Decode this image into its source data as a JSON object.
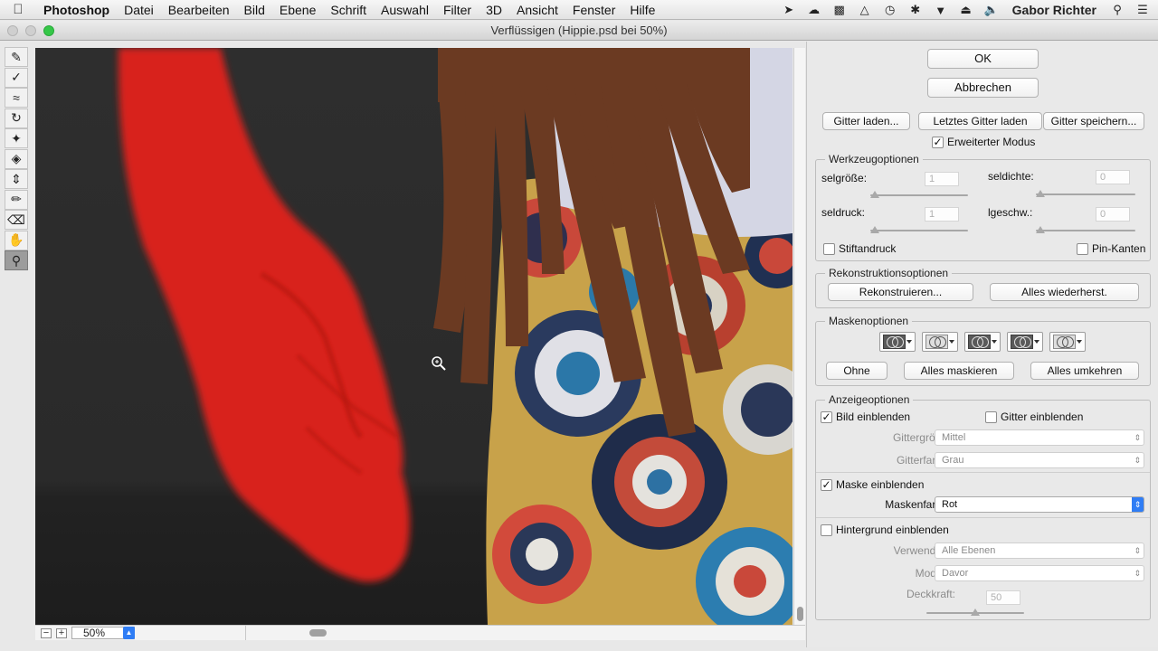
{
  "menubar": {
    "apple_icon": "apple-logo-icon",
    "app_name": "Photoshop",
    "items": [
      "Datei",
      "Bearbeiten",
      "Bild",
      "Ebene",
      "Schrift",
      "Auswahl",
      "Filter",
      "3D",
      "Ansicht",
      "Fenster",
      "Hilfe"
    ],
    "user": "Gabor Richter"
  },
  "window": {
    "title": "Verflüssigen (Hippie.psd bei 50%)"
  },
  "tools": [
    "forward-warp-tool-icon",
    "reconstruct-tool-icon",
    "smooth-tool-icon",
    "twirl-clockwise-tool-icon",
    "pucker-tool-icon",
    "bloat-tool-icon",
    "push-left-tool-icon",
    "freeze-mask-tool-icon",
    "thaw-mask-tool-icon",
    "hand-tool-icon",
    "zoom-tool-icon"
  ],
  "statusbar": {
    "zoom_out": "−",
    "zoom_in": "+",
    "zoom_value": "50%"
  },
  "panel": {
    "ok": "OK",
    "cancel": "Abbrechen",
    "mesh": {
      "load": "Gitter laden...",
      "load_last": "Letztes Gitter laden",
      "save": "Gitter speichern..."
    },
    "advanced_mode": {
      "label": "Erweiterter Modus",
      "checked": true
    },
    "tool_options": {
      "title": "Werkzeugoptionen",
      "brush_size": {
        "label": "selgröße:",
        "value": "1"
      },
      "brush_density": {
        "label": "seldichte:",
        "value": "0"
      },
      "brush_pressure": {
        "label": "seldruck:",
        "value": "1"
      },
      "brush_rate": {
        "label": "lgeschw.:",
        "value": "0"
      },
      "stylus_pressure": {
        "label": "Stiftandruck",
        "checked": false
      },
      "pin_edges": {
        "label": "Pin-Kanten",
        "checked": false
      }
    },
    "reconstruct_options": {
      "title": "Rekonstruktionsoptionen",
      "reconstruct": "Rekonstruieren...",
      "restore_all": "Alles wiederherst."
    },
    "mask_options": {
      "title": "Maskenoptionen",
      "none": "Ohne",
      "mask_all": "Alles maskieren",
      "invert_all": "Alles umkehren"
    },
    "view_options": {
      "title": "Anzeigeoptionen",
      "show_image": {
        "label": "Bild einblenden",
        "checked": true
      },
      "show_mesh": {
        "label": "Gitter einblenden",
        "checked": false
      },
      "mesh_size": {
        "label": "Gittergröße:",
        "value": "Mittel"
      },
      "mesh_color": {
        "label": "Gitterfarbe:",
        "value": "Grau"
      },
      "show_mask": {
        "label": "Maske einblenden",
        "checked": true
      },
      "mask_color": {
        "label": "Maskenfarbe:",
        "value": "Rot"
      },
      "show_backdrop": {
        "label": "Hintergrund einblenden",
        "checked": false
      },
      "use": {
        "label": "Verwenden:",
        "value": "Alle Ebenen"
      },
      "mode": {
        "label": "Modus:",
        "value": "Davor"
      },
      "opacity": {
        "label": "Deckkraft:",
        "value": "50"
      }
    }
  }
}
